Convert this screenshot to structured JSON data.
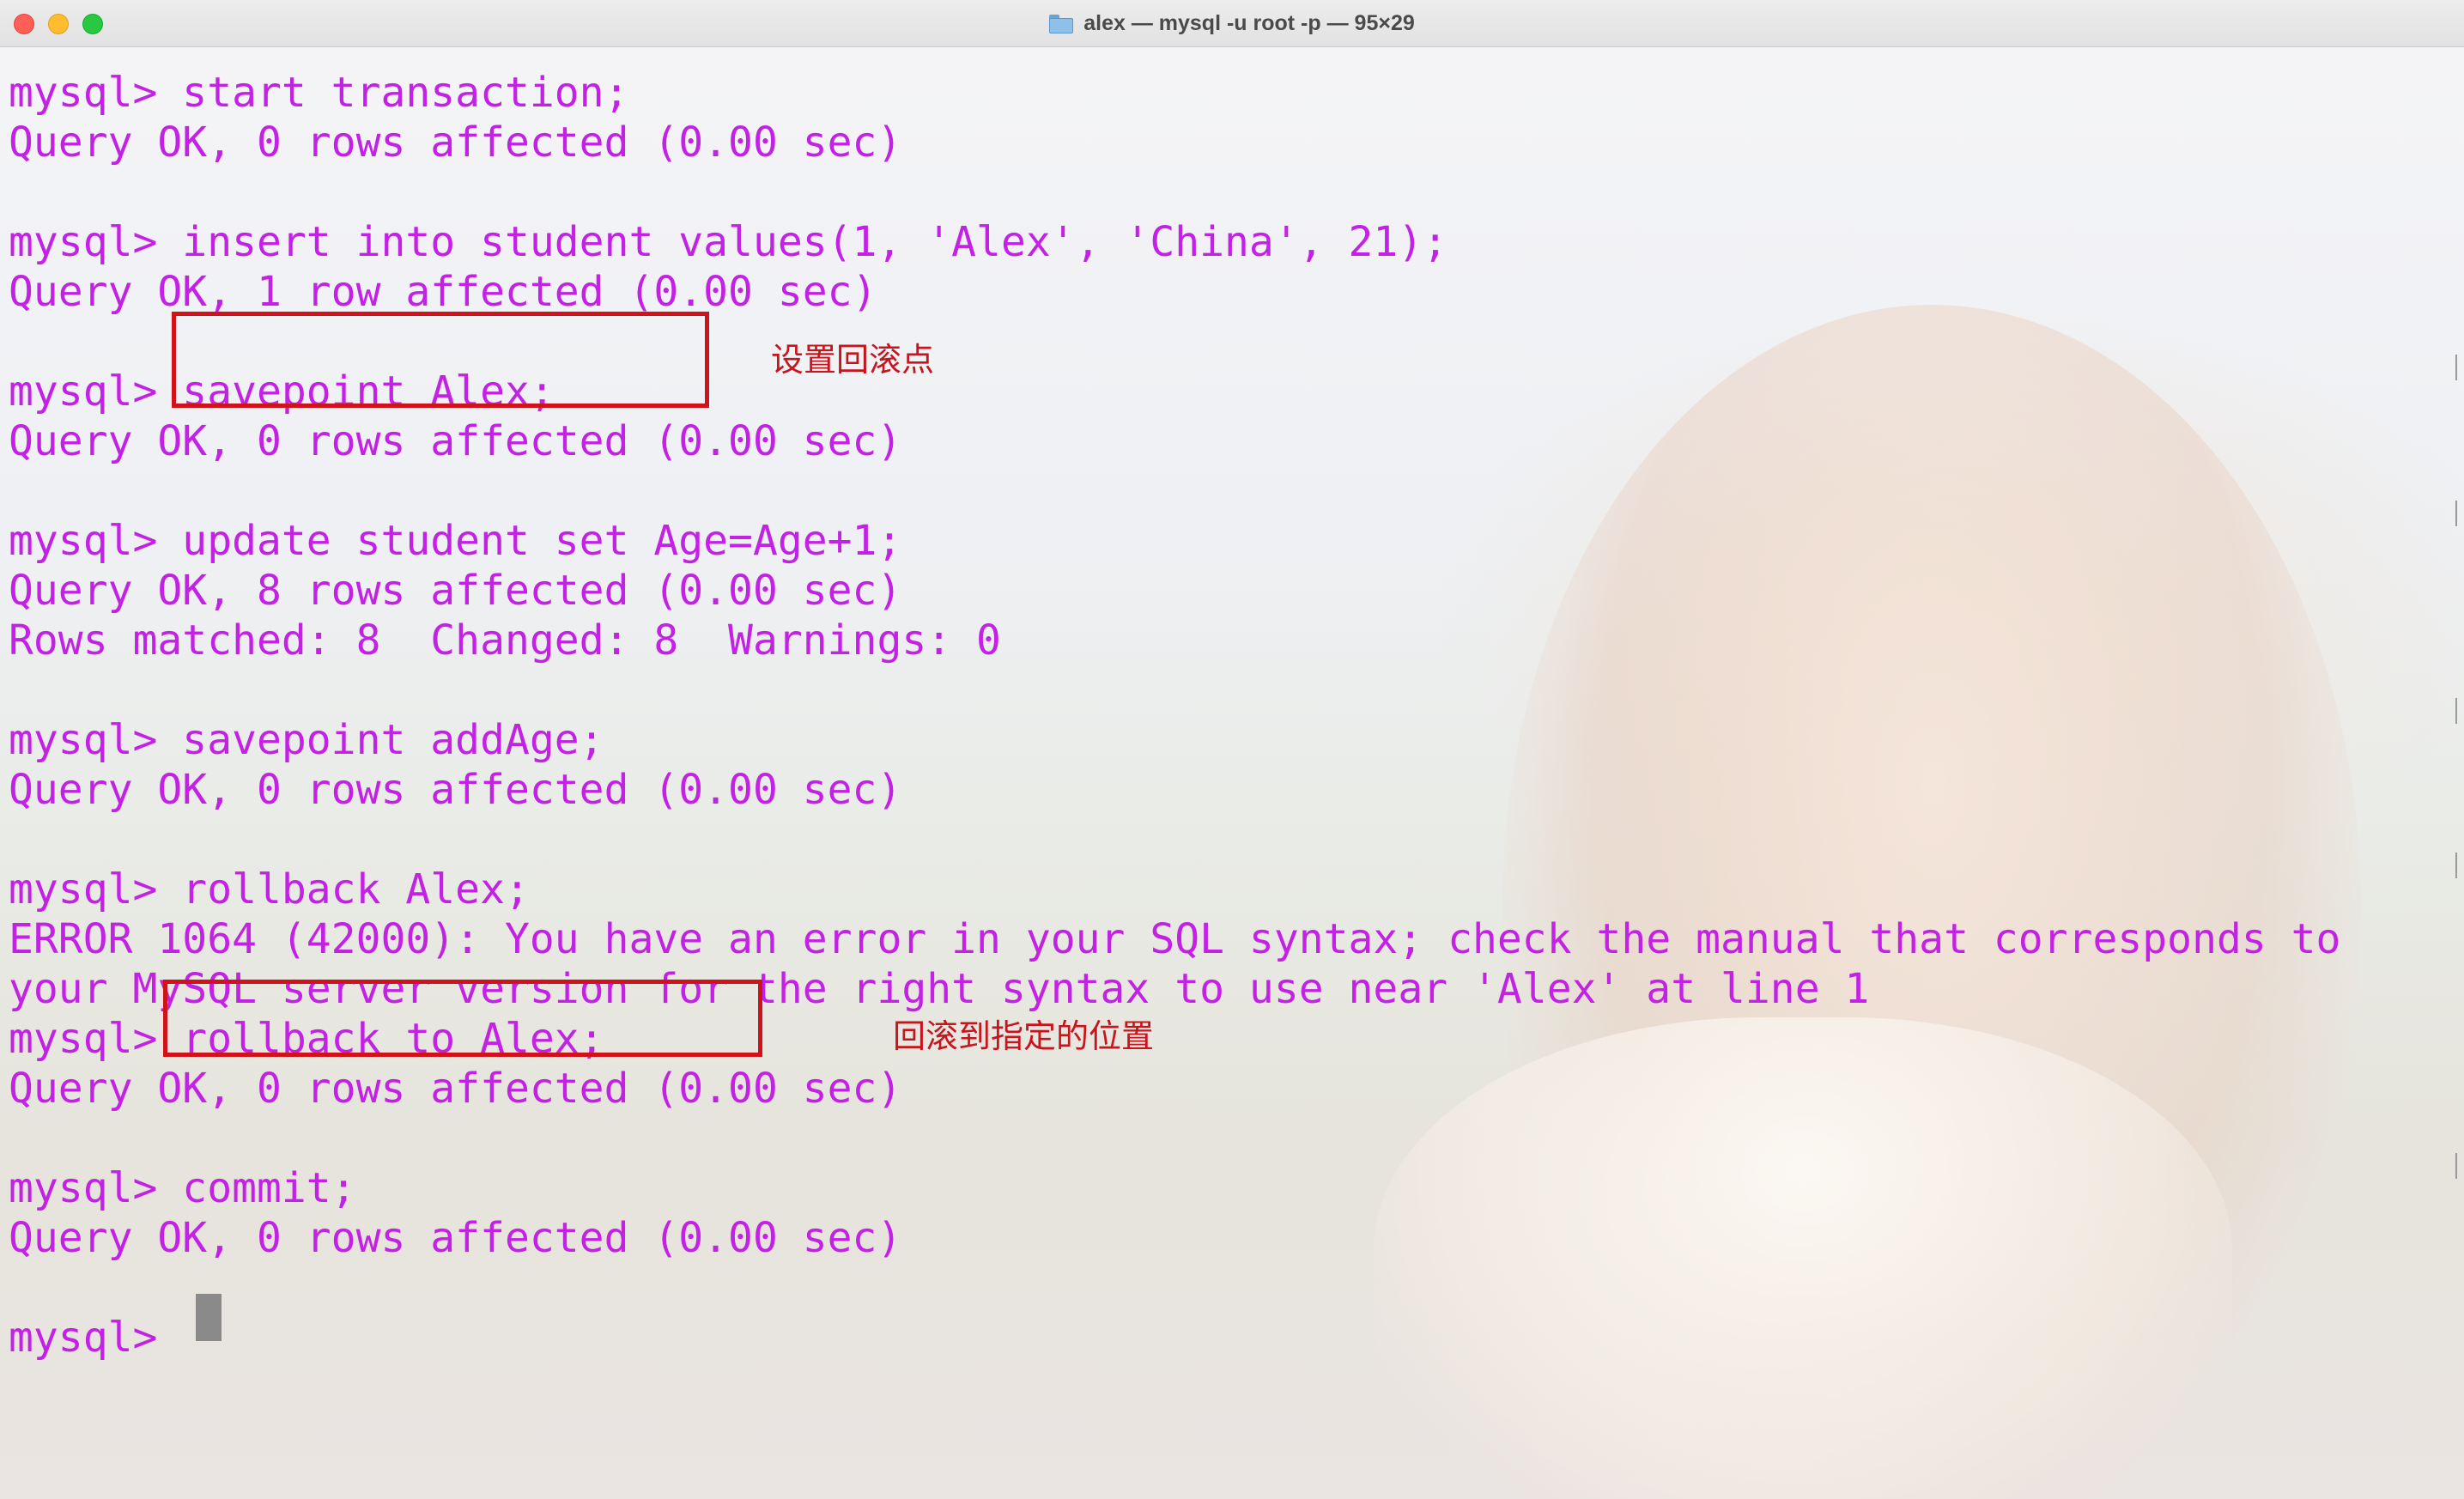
{
  "window": {
    "title": "alex — mysql -u root -p — 95×29"
  },
  "terminal": {
    "lines": [
      "mysql> start transaction;",
      "Query OK, 0 rows affected (0.00 sec)",
      "",
      "mysql> insert into student values(1, 'Alex', 'China', 21);",
      "Query OK, 1 row affected (0.00 sec)",
      "",
      "mysql> savepoint Alex;",
      "Query OK, 0 rows affected (0.00 sec)",
      "",
      "mysql> update student set Age=Age+1;",
      "Query OK, 8 rows affected (0.00 sec)",
      "Rows matched: 8  Changed: 8  Warnings: 0",
      "",
      "mysql> savepoint addAge;",
      "Query OK, 0 rows affected (0.00 sec)",
      "",
      "mysql> rollback Alex;",
      "ERROR 1064 (42000): You have an error in your SQL syntax; check the manual that corresponds to",
      "your MySQL server version for the right syntax to use near 'Alex' at line 1",
      "mysql> rollback to Alex;",
      "Query OK, 0 rows affected (0.00 sec)",
      "",
      "mysql> commit;",
      "Query OK, 0 rows affected (0.00 sec)",
      "",
      "mysql> "
    ],
    "text_color": "#c321e4"
  },
  "annotations": {
    "savepoint_note": "设置回滚点",
    "rollback_note": "回滚到指定的位置",
    "box_color": "#d0121b"
  }
}
